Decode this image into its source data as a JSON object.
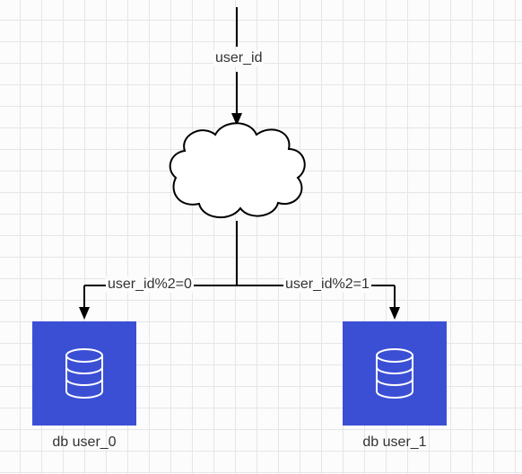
{
  "diagram": {
    "input_label": "user_id",
    "branch_left_label": "user_id%2=0",
    "branch_right_label": "user_id%2=1",
    "db_left_caption": "db user_0",
    "db_right_caption": "db user_1"
  }
}
